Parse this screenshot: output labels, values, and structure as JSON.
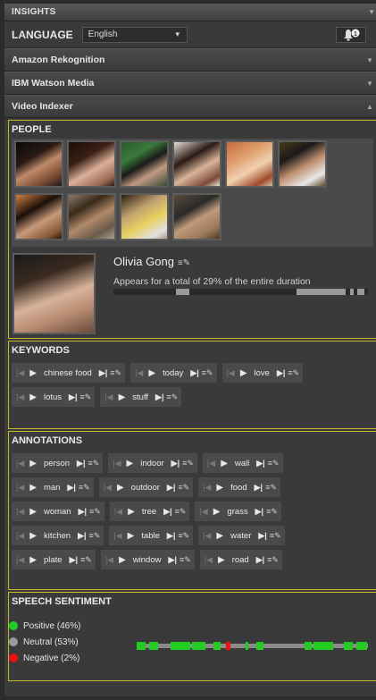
{
  "header": {
    "title": "INSIGHTS"
  },
  "language": {
    "label": "LANGUAGE",
    "selected": "English",
    "badge": "1"
  },
  "accordions": [
    {
      "label": "Amazon Rekognition",
      "state": "collapsed"
    },
    {
      "label": "IBM Watson Media",
      "state": "collapsed"
    },
    {
      "label": "Video Indexer",
      "state": "expanded"
    }
  ],
  "people": {
    "title": "PEOPLE",
    "selected": {
      "name": "Olivia Gong",
      "appears": "Appears for a total of 29% of the entire duration",
      "share_fraction": 0.29
    }
  },
  "keywords": {
    "title": "KEYWORDS",
    "rows": [
      [
        "chinese food",
        "today",
        "love"
      ],
      [
        "lotus",
        "stuff"
      ]
    ]
  },
  "annotations": {
    "title": "ANNOTATIONS",
    "rows": [
      [
        "person",
        "indoor",
        "wall"
      ],
      [
        "man",
        "outdoor",
        "food"
      ],
      [
        "woman",
        "tree",
        "grass"
      ],
      [
        "kitchen",
        "table",
        "water"
      ],
      [
        "plate",
        "window",
        "road"
      ]
    ]
  },
  "sentiment": {
    "title": "SPEECH SENTIMENT",
    "items": [
      {
        "label": "Positive (46%)",
        "color": "#22cc22",
        "percent": 46
      },
      {
        "label": "Neutral (53%)",
        "color": "#9a9a9a",
        "percent": 53
      },
      {
        "label": "Negative (2%)",
        "color": "#ee1111",
        "percent": 2
      }
    ]
  },
  "colors": {
    "panel_border": "#c8b92c",
    "positive": "#22cc22",
    "negative": "#ee1111"
  }
}
